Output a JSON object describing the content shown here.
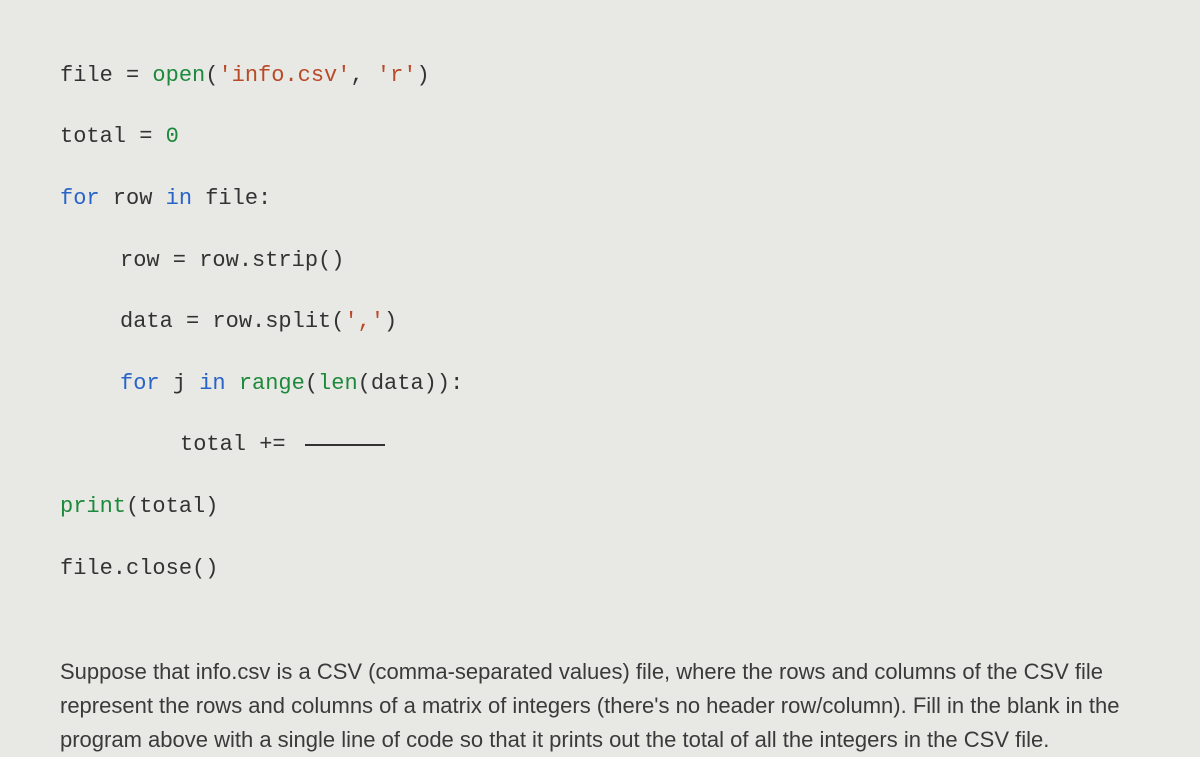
{
  "code": {
    "line1_a": "file = ",
    "line1_b": "open",
    "line1_c": "(",
    "line1_d": "'info.csv'",
    "line1_e": ", ",
    "line1_f": "'r'",
    "line1_g": ")",
    "line2_a": "total = ",
    "line2_b": "0",
    "line3_a": "for",
    "line3_b": " row ",
    "line3_c": "in",
    "line3_d": " file:",
    "line4_a": "row = row.strip()",
    "line5_a": "data = row.split(",
    "line5_b": "','",
    "line5_c": ")",
    "line6_a": "for",
    "line6_b": " j ",
    "line6_c": "in",
    "line6_d": " ",
    "line6_e": "range",
    "line6_f": "(",
    "line6_g": "len",
    "line6_h": "(data)):",
    "line7_a": "total += ",
    "line8_a": "print",
    "line8_b": "(total)",
    "line9_a": "file.close()"
  },
  "question": "Suppose that info.csv is a CSV (comma-separated values) file, where the rows and columns of the CSV file represent the rows and columns of a matrix of integers (there's no header row/column).  Fill in the blank in the program above with a single line of code so that it prints out the total of all the integers in the CSV file."
}
